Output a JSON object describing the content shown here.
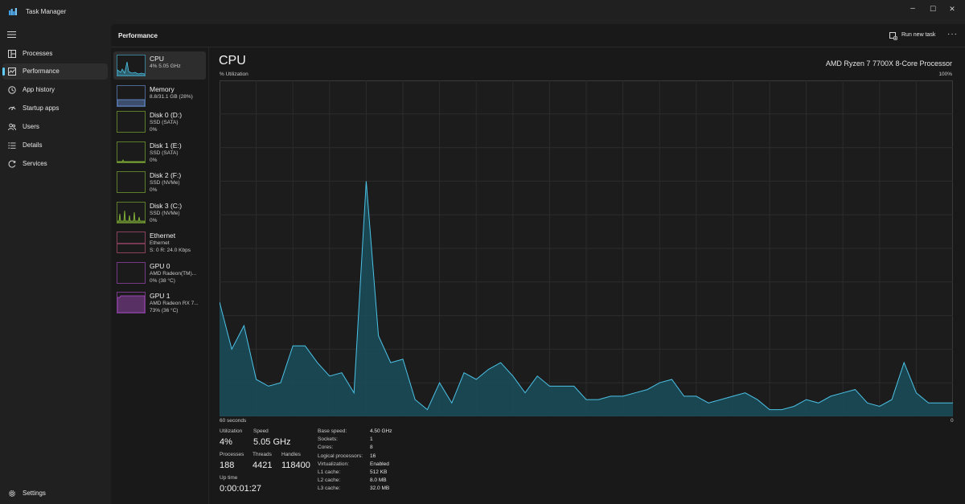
{
  "app": {
    "title": "Task Manager"
  },
  "window_controls": {
    "minimize": "–",
    "maximize": "☐",
    "close": "✕"
  },
  "nav": {
    "items": [
      {
        "label": "Processes",
        "icon": "processes-icon"
      },
      {
        "label": "Performance",
        "icon": "performance-icon",
        "active": true
      },
      {
        "label": "App history",
        "icon": "history-icon"
      },
      {
        "label": "Startup apps",
        "icon": "startup-icon"
      },
      {
        "label": "Users",
        "icon": "users-icon"
      },
      {
        "label": "Details",
        "icon": "details-icon"
      },
      {
        "label": "Services",
        "icon": "services-icon"
      }
    ],
    "settings": {
      "label": "Settings",
      "icon": "gear-icon"
    }
  },
  "header": {
    "title": "Performance",
    "run_new_task": "Run new task",
    "more": "···"
  },
  "resources": [
    {
      "name": "CPU",
      "lines": [
        "4%  5.05 GHz"
      ],
      "color": "#4cc2e6"
    },
    {
      "name": "Memory",
      "lines": [
        "8.8/31.1 GB (28%)"
      ],
      "color": "#6f9ce6"
    },
    {
      "name": "Disk 0 (D:)",
      "lines": [
        "SSD (SATA)",
        "0%"
      ],
      "color": "#8bbf3a"
    },
    {
      "name": "Disk 1 (E:)",
      "lines": [
        "SSD (SATA)",
        "0%"
      ],
      "color": "#8bbf3a"
    },
    {
      "name": "Disk 2 (F:)",
      "lines": [
        "SSD (NVMe)",
        "0%"
      ],
      "color": "#8bbf3a"
    },
    {
      "name": "Disk 3 (C:)",
      "lines": [
        "SSD (NVMe)",
        "0%"
      ],
      "color": "#8bbf3a"
    },
    {
      "name": "Ethernet",
      "lines": [
        "Ethernet",
        "S: 0  R: 24.0 Kbps"
      ],
      "color": "#d45a8a"
    },
    {
      "name": "GPU 0",
      "lines": [
        "AMD Radeon(TM)...",
        "0% (38 °C)"
      ],
      "color": "#b34fd0"
    },
    {
      "name": "GPU 1",
      "lines": [
        "AMD Radeon RX 7...",
        "73% (36 °C)"
      ],
      "color": "#b34fd0"
    }
  ],
  "cpu": {
    "title": "CPU",
    "model": "AMD Ryzen 7 7700X 8-Core Processor",
    "y_label": "% Utilization",
    "y_max_label": "100%",
    "x_left_label": "60 seconds",
    "x_right_label": "0",
    "stats": {
      "utilization_label": "Utilization",
      "utilization": "4%",
      "speed_label": "Speed",
      "speed": "5.05 GHz",
      "processes_label": "Processes",
      "processes": "188",
      "threads_label": "Threads",
      "threads": "4421",
      "handles_label": "Handles",
      "handles": "118400",
      "uptime_label": "Up time",
      "uptime": "0:00:01:27"
    },
    "details": [
      {
        "label": "Base speed:",
        "value": "4.50 GHz"
      },
      {
        "label": "Sockets:",
        "value": "1"
      },
      {
        "label": "Cores:",
        "value": "8"
      },
      {
        "label": "Logical processors:",
        "value": "16"
      },
      {
        "label": "Virtualization:",
        "value": "Enabled"
      },
      {
        "label": "L1 cache:",
        "value": "512 KB"
      },
      {
        "label": "L2 cache:",
        "value": "8.0 MB"
      },
      {
        "label": "L3 cache:",
        "value": "32.0 MB"
      }
    ]
  },
  "chart_data": {
    "type": "area",
    "title": "CPU",
    "ylabel": "% Utilization",
    "xlabel": "60 seconds",
    "ylim": [
      0,
      100
    ],
    "x": [
      60,
      59,
      58,
      57,
      56,
      55,
      54,
      53,
      52,
      51,
      50,
      49,
      48,
      47,
      46,
      45,
      44,
      43,
      42,
      41,
      40,
      39,
      38,
      37,
      36,
      35,
      34,
      33,
      32,
      31,
      30,
      29,
      28,
      27,
      26,
      25,
      24,
      23,
      22,
      21,
      20,
      19,
      18,
      17,
      16,
      15,
      14,
      13,
      12,
      11,
      10,
      9,
      8,
      7,
      6,
      5,
      4,
      3,
      2,
      1,
      0
    ],
    "series": [
      {
        "values": [
          34,
          20,
          27,
          11,
          9,
          10,
          21,
          21,
          16,
          12,
          13,
          7,
          70,
          24,
          16,
          17,
          5,
          2,
          10,
          4,
          13,
          11,
          14,
          16,
          12,
          7,
          12,
          9,
          9,
          9,
          5,
          5,
          6,
          6,
          7,
          8,
          10,
          11,
          6,
          6,
          4,
          5,
          6,
          7,
          5,
          2,
          2,
          3,
          5,
          4,
          6,
          7,
          8,
          4,
          3,
          5,
          16,
          7,
          4,
          4,
          4
        ],
        "color": "#4cc2e6"
      }
    ],
    "grid": true
  }
}
